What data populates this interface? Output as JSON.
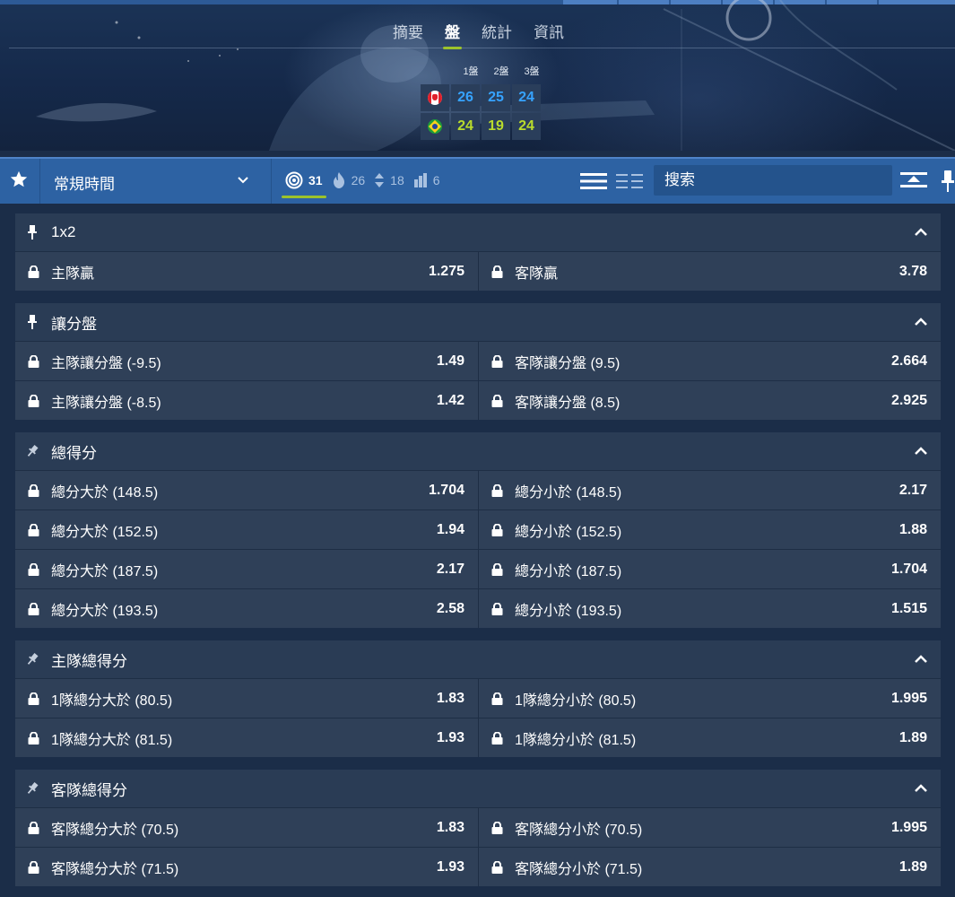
{
  "tabs": [
    {
      "label": "摘要",
      "active": false
    },
    {
      "label": "盤",
      "active": true
    },
    {
      "label": "統計",
      "active": false
    },
    {
      "label": "資訊",
      "active": false
    }
  ],
  "scoreboard": {
    "headers": [
      "1盤",
      "2盤",
      "3盤"
    ],
    "teams": [
      {
        "flag": "canada-flag-icon",
        "scores": [
          "26",
          "25",
          "24"
        ],
        "color": "#36a3ff"
      },
      {
        "flag": "brazil-flag-icon",
        "scores": [
          "24",
          "19",
          "24"
        ],
        "color": "#b9dc2c"
      }
    ]
  },
  "toolbar": {
    "period_select": "常規時間",
    "counters": [
      {
        "icon": "target-icon",
        "value": "31",
        "active": true
      },
      {
        "icon": "fire-icon",
        "value": "26",
        "active": false
      },
      {
        "icon": "up-down-arrows-icon",
        "value": "18",
        "active": false
      },
      {
        "icon": "ladder-icon",
        "value": "6",
        "active": false
      }
    ],
    "search_placeholder": "搜索"
  },
  "colors": {
    "accent_green": "#9cc32b",
    "home_score": "#36a3ff",
    "away_score": "#b9dc2c",
    "toolbar_blue": "#2d62a3"
  },
  "markets": [
    {
      "title": "1x2",
      "pinned": true,
      "rows": [
        [
          {
            "label": "主隊贏",
            "odds": "1.275"
          },
          {
            "label": "客隊贏",
            "odds": "3.78"
          }
        ]
      ]
    },
    {
      "title": "讓分盤",
      "pinned": true,
      "rows": [
        [
          {
            "label": "主隊讓分盤 (-9.5)",
            "odds": "1.49"
          },
          {
            "label": "客隊讓分盤 (9.5)",
            "odds": "2.664"
          }
        ],
        [
          {
            "label": "主隊讓分盤 (-8.5)",
            "odds": "1.42"
          },
          {
            "label": "客隊讓分盤 (8.5)",
            "odds": "2.925"
          }
        ]
      ]
    },
    {
      "title": "總得分",
      "pinned": false,
      "rows": [
        [
          {
            "label": "總分大於 (148.5)",
            "odds": "1.704"
          },
          {
            "label": "總分小於 (148.5)",
            "odds": "2.17"
          }
        ],
        [
          {
            "label": "總分大於 (152.5)",
            "odds": "1.94"
          },
          {
            "label": "總分小於 (152.5)",
            "odds": "1.88"
          }
        ],
        [
          {
            "label": "總分大於 (187.5)",
            "odds": "2.17"
          },
          {
            "label": "總分小於 (187.5)",
            "odds": "1.704"
          }
        ],
        [
          {
            "label": "總分大於 (193.5)",
            "odds": "2.58"
          },
          {
            "label": "總分小於 (193.5)",
            "odds": "1.515"
          }
        ]
      ]
    },
    {
      "title": "主隊總得分",
      "pinned": false,
      "rows": [
        [
          {
            "label": "1隊總分大於 (80.5)",
            "odds": "1.83"
          },
          {
            "label": "1隊總分小於 (80.5)",
            "odds": "1.995"
          }
        ],
        [
          {
            "label": "1隊總分大於 (81.5)",
            "odds": "1.93"
          },
          {
            "label": "1隊總分小於 (81.5)",
            "odds": "1.89"
          }
        ]
      ]
    },
    {
      "title": "客隊總得分",
      "pinned": false,
      "rows": [
        [
          {
            "label": "客隊總分大於 (70.5)",
            "odds": "1.83"
          },
          {
            "label": "客隊總分小於 (70.5)",
            "odds": "1.995"
          }
        ],
        [
          {
            "label": "客隊總分大於 (71.5)",
            "odds": "1.93"
          },
          {
            "label": "客隊總分小於 (71.5)",
            "odds": "1.89"
          }
        ]
      ]
    }
  ]
}
